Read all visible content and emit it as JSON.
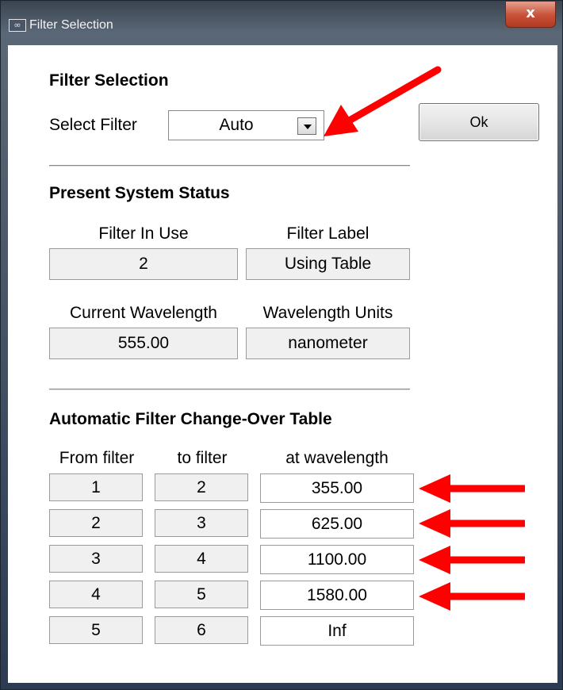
{
  "window": {
    "title": "Filter Selection",
    "close_glyph": "x"
  },
  "filter_selection": {
    "heading": "Filter Selection",
    "select_label": "Select Filter",
    "select_value": "Auto",
    "ok_label": "Ok"
  },
  "status": {
    "heading": "Present System Status",
    "filter_in_use_label": "Filter In Use",
    "filter_in_use_value": "2",
    "filter_label_label": "Filter Label",
    "filter_label_value": "Using Table",
    "wavelength_label": "Current Wavelength",
    "wavelength_value": "555.00",
    "units_label": "Wavelength Units",
    "units_value": "nanometer"
  },
  "table": {
    "heading": "Automatic Filter Change-Over Table",
    "columns": [
      "From filter",
      "to filter",
      "at wavelength"
    ],
    "rows": [
      {
        "from": "1",
        "to": "2",
        "at": "355.00"
      },
      {
        "from": "2",
        "to": "3",
        "at": "625.00"
      },
      {
        "from": "3",
        "to": "4",
        "at": "1100.00"
      },
      {
        "from": "4",
        "to": "5",
        "at": "1580.00"
      },
      {
        "from": "5",
        "to": "6",
        "at": "Inf"
      }
    ]
  },
  "annotation_color": "#ff0000"
}
